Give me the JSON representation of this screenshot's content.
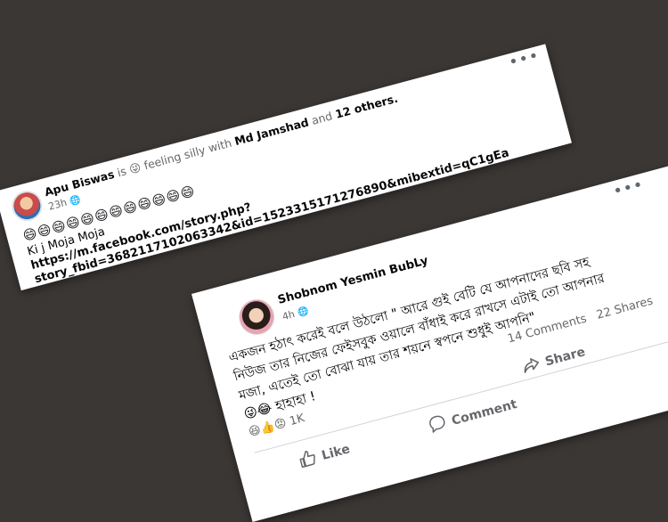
{
  "post1": {
    "author": "Apu Biswas",
    "header_is": "is",
    "feeling_emoji": "😜",
    "feeling": "feeling silly with",
    "tagged": "Md Jamshad",
    "and": "and",
    "others": "12 others.",
    "time": "23h",
    "emojis": "😄😄😄😄😄😄😄😄😄😄😄😄",
    "line1": "Ki j Moja Moja",
    "line2": "https://m.facebook.com/story.php?",
    "line3": "story_fbid=3682117102063342&id=1523315171276890&mibextid=qC1gEa",
    "more": "•••"
  },
  "post2": {
    "author": "Shobnom Yesmin BubLy",
    "time": "4h",
    "more": "•••",
    "text_lines": [
      "একজন হঠাৎ করেই বলে উঠলো \" আরে গুই বেটি যে আপনাদের ছবি সহ",
      "নিউজ তার নিজের ফেইসবুক ওয়ালে বাঁধাই করে রাখসে এটাই তো আপনার",
      "মজা, এতেই তো বোঝা যায় তার শয়নে স্বপনে শুধুই আপনি\"",
      "😜😂 হাহাহা !"
    ],
    "reactions": "😆👍😡",
    "reaction_count": "1K",
    "comments": "14 Comments",
    "shares": "22 Shares",
    "like_label": "Like",
    "comment_label": "Comment",
    "share_label": "Share"
  }
}
